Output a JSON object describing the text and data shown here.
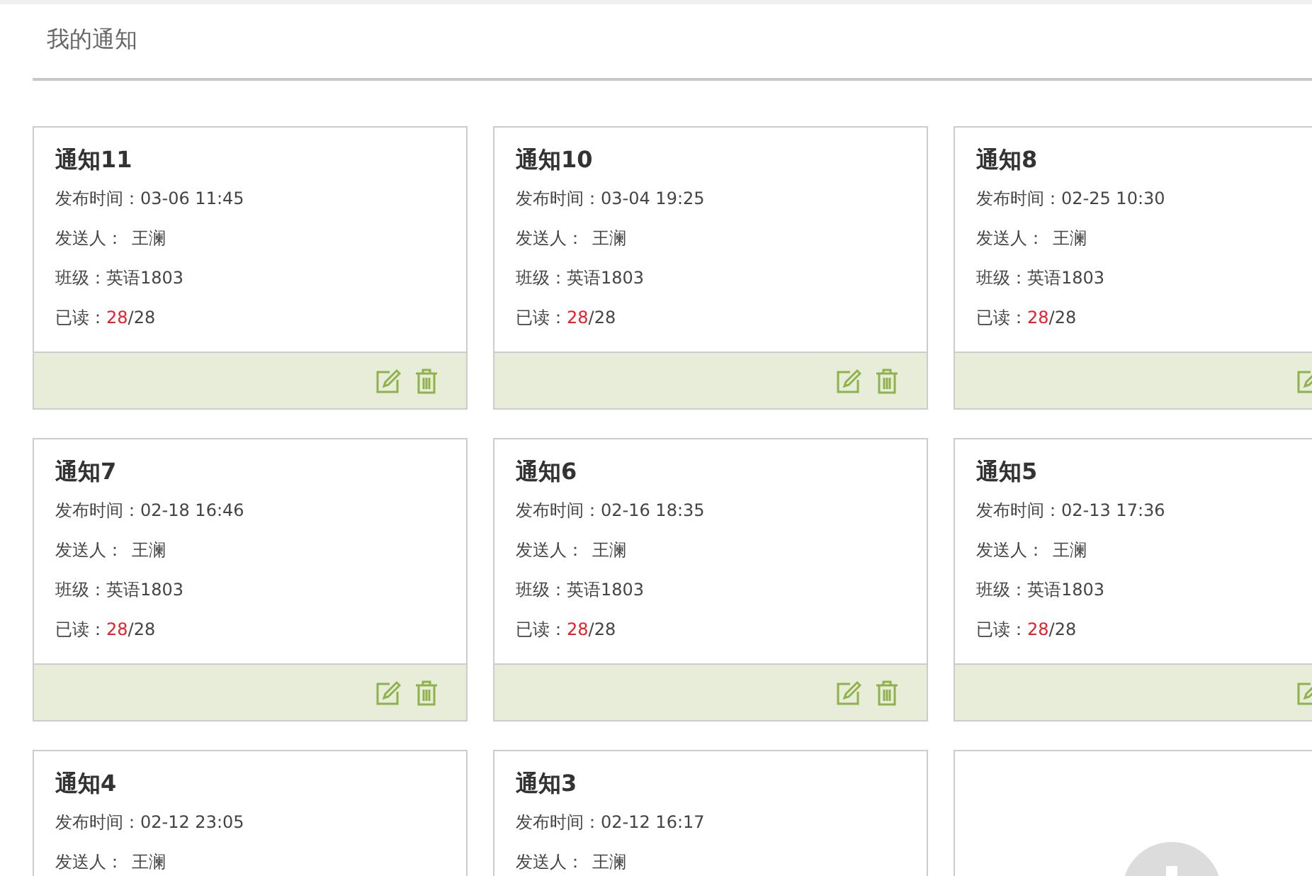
{
  "header": {
    "title": "我的通知"
  },
  "cards": [
    {
      "kind": "notice",
      "title": "通知11",
      "time_label": "发布时间：",
      "time": "03-06 11:45",
      "sender_label": "发送人：",
      "sender": "王澜",
      "class_label": "班级：",
      "class_name": "英语1803",
      "read_label": "已读：",
      "read": "28",
      "total": "/28"
    },
    {
      "kind": "notice",
      "title": "通知10",
      "time_label": "发布时间：",
      "time": "03-04 19:25",
      "sender_label": "发送人：",
      "sender": "王澜",
      "class_label": "班级：",
      "class_name": "英语1803",
      "read_label": "已读：",
      "read": "28",
      "total": "/28"
    },
    {
      "kind": "notice",
      "title": "通知8",
      "time_label": "发布时间：",
      "time": "02-25 10:30",
      "sender_label": "发送人：",
      "sender": "王澜",
      "class_label": "班级：",
      "class_name": "英语1803",
      "read_label": "已读：",
      "read": "28",
      "total": "/28"
    },
    {
      "kind": "notice",
      "title": "通知7",
      "time_label": "发布时间：",
      "time": "02-18 16:46",
      "sender_label": "发送人：",
      "sender": "王澜",
      "class_label": "班级：",
      "class_name": "英语1803",
      "read_label": "已读：",
      "read": "28",
      "total": "/28"
    },
    {
      "kind": "notice",
      "title": "通知6",
      "time_label": "发布时间：",
      "time": "02-16 18:35",
      "sender_label": "发送人：",
      "sender": "王澜",
      "class_label": "班级：",
      "class_name": "英语1803",
      "read_label": "已读：",
      "read": "28",
      "total": "/28"
    },
    {
      "kind": "notice",
      "title": "通知5",
      "time_label": "发布时间：",
      "time": "02-13 17:36",
      "sender_label": "发送人：",
      "sender": "王澜",
      "class_label": "班级：",
      "class_name": "英语1803",
      "read_label": "已读：",
      "read": "28",
      "total": "/28"
    },
    {
      "kind": "notice",
      "title": "通知4",
      "time_label": "发布时间：",
      "time": "02-12 23:05",
      "sender_label": "发送人：",
      "sender": "王澜"
    },
    {
      "kind": "notice",
      "title": "通知3",
      "time_label": "发布时间：",
      "time": "02-12 16:17",
      "sender_label": "发送人：",
      "sender": "王澜"
    },
    {
      "kind": "add"
    }
  ]
}
